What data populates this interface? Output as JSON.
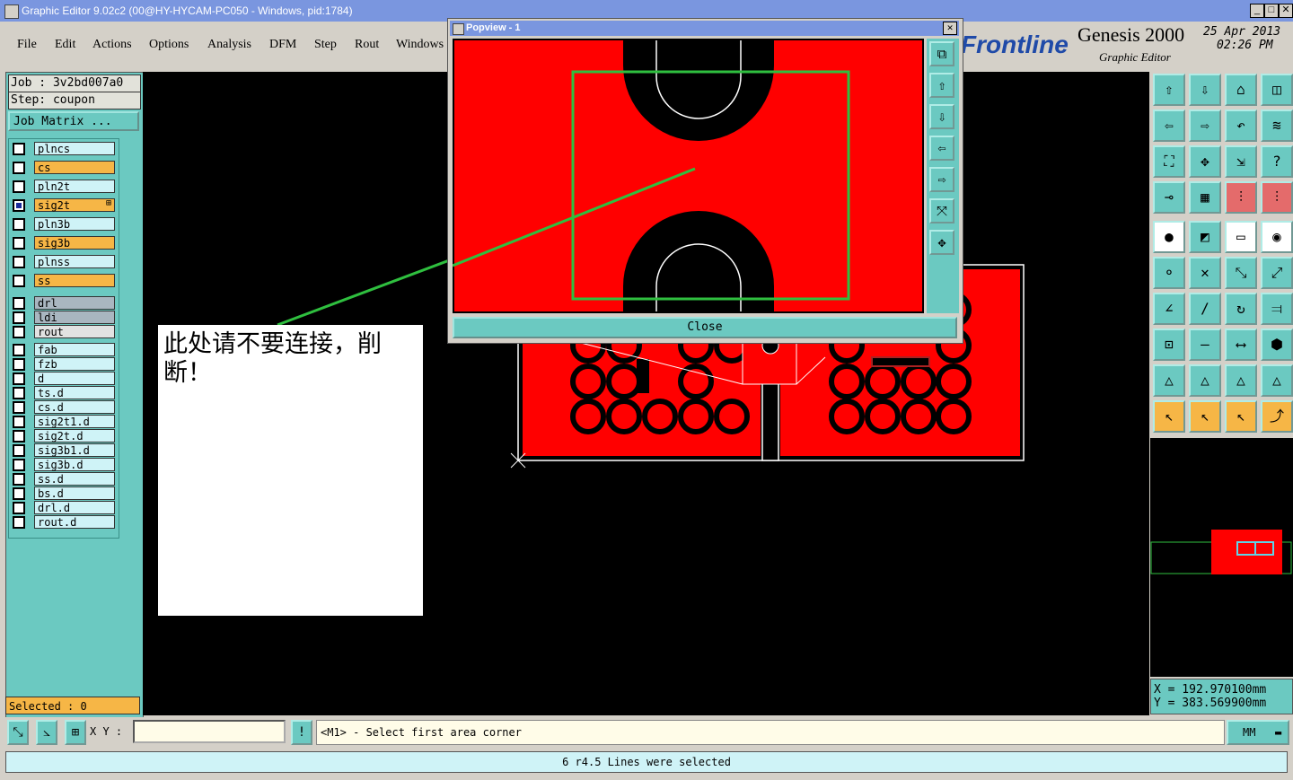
{
  "window": {
    "title": "Graphic Editor 9.02c2 (00@HY-HYCAM-PC050 - Windows, pid:1784)"
  },
  "menu": [
    "File",
    "Edit",
    "Actions",
    "Options",
    "Analysis",
    "DFM",
    "Step",
    "Rout",
    "Windows"
  ],
  "brand": {
    "logo": "Frontline",
    "product": "Genesis 2000",
    "subtitle": "Graphic Editor",
    "date": "25 Apr 2013",
    "time": "02:26 PM"
  },
  "job": {
    "job_label": "Job  :  3v2bd007a0",
    "step_label": "Step:  coupon",
    "matrix_button": "Job Matrix ..."
  },
  "layers": [
    {
      "name": "plncs",
      "color": "#cff3f7"
    },
    {
      "name": "cs",
      "color": "#f6b646"
    },
    {
      "name": "pln2t",
      "color": "#cff3f7"
    },
    {
      "name": "sig2t",
      "color": "#f6b646",
      "active": true,
      "mark": "⊞"
    },
    {
      "name": "pln3b",
      "color": "#cff3f7"
    },
    {
      "name": "sig3b",
      "color": "#f6b646"
    },
    {
      "name": "plnss",
      "color": "#cff3f7"
    },
    {
      "name": "ss",
      "color": "#f6b646"
    },
    {
      "name": "drl",
      "color": "#a9b6c0"
    },
    {
      "name": "ldi",
      "color": "#a9b6c0"
    },
    {
      "name": "rout",
      "color": "#e2e2e2"
    },
    {
      "name": "fab",
      "color": "#cff3f7"
    },
    {
      "name": "fzb",
      "color": "#cff3f7"
    },
    {
      "name": "d",
      "color": "#cff3f7"
    },
    {
      "name": "ts.d",
      "color": "#cff3f7"
    },
    {
      "name": "cs.d",
      "color": "#cff3f7"
    },
    {
      "name": "sig2t1.d",
      "color": "#cff3f7"
    },
    {
      "name": "sig2t.d",
      "color": "#cff3f7"
    },
    {
      "name": "sig3b1.d",
      "color": "#cff3f7"
    },
    {
      "name": "sig3b.d",
      "color": "#cff3f7"
    },
    {
      "name": "ss.d",
      "color": "#cff3f7"
    },
    {
      "name": "bs.d",
      "color": "#cff3f7"
    },
    {
      "name": "drl.d",
      "color": "#cff3f7"
    },
    {
      "name": "rout.d",
      "color": "#cff3f7"
    }
  ],
  "selected": "Selected : 0",
  "note": "此处请不要连接，削断！",
  "popview": {
    "title": "Popview - 1",
    "close_label": "Close"
  },
  "coords": {
    "x": "X  =  192.970100mm",
    "y": "Y  =  383.569900mm"
  },
  "bottom": {
    "xy_label": "X Y :",
    "bang": "!",
    "command": "<M1> - Select first area corner",
    "units": "MM"
  },
  "status": "6 r4.5 Lines were selected",
  "colors": {
    "copper": "#ff0000",
    "panel": "#6bc9c1",
    "highlight": "#f6b646",
    "selection_box": "#2fbf3f"
  }
}
